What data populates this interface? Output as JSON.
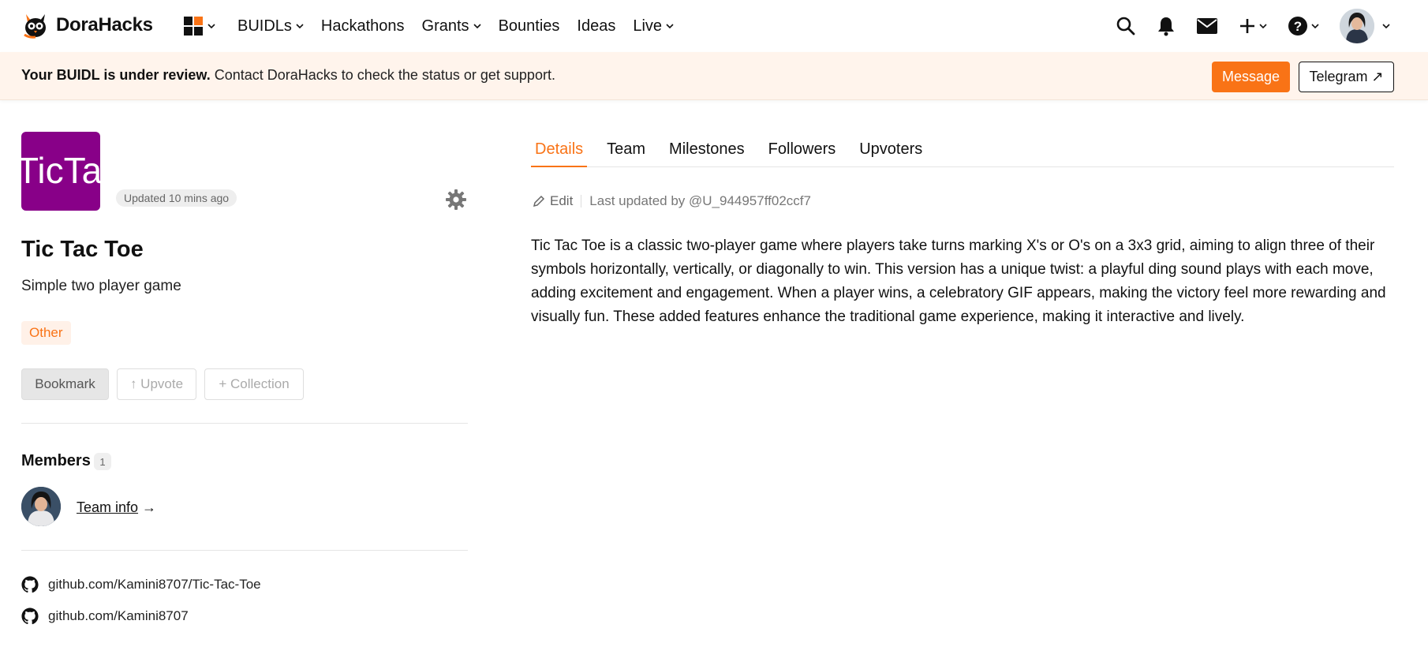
{
  "brand": {
    "name": "DoraHacks",
    "accent": "#f97316"
  },
  "nav": {
    "items": [
      {
        "label": "BUIDLs",
        "dropdown": true
      },
      {
        "label": "Hackathons",
        "dropdown": false
      },
      {
        "label": "Grants",
        "dropdown": true
      },
      {
        "label": "Bounties",
        "dropdown": false
      },
      {
        "label": "Ideas",
        "dropdown": false
      },
      {
        "label": "Live",
        "dropdown": true
      }
    ],
    "right_icons": [
      "search-icon",
      "bell-icon",
      "mail-icon",
      "plus-icon",
      "help-icon",
      "avatar"
    ]
  },
  "banner": {
    "bold": "Your BUIDL is under review.",
    "text": " Contact DoraHacks to check the status or get support.",
    "message_label": "Message",
    "telegram_label": "Telegram ↗"
  },
  "project": {
    "logo_text": "TicTac",
    "logo_color": "#880088",
    "updated": "Updated 10 mins ago",
    "title": "Tic Tac Toe",
    "tagline": "Simple two player game",
    "tag": "Other",
    "bookmark_label": "Bookmark",
    "upvote_label": "↑ Upvote",
    "collection_label": "+ Collection"
  },
  "members": {
    "label": "Members",
    "count": "1",
    "team_info_label": "Team info",
    "team_info_arrow": " →"
  },
  "links": [
    {
      "icon": "github-icon",
      "text": "github.com/Kamini8707/Tic-Tac-Toe"
    },
    {
      "icon": "github-icon",
      "text": "github.com/Kamini8707"
    }
  ],
  "tabs": [
    {
      "label": "Details",
      "active": true
    },
    {
      "label": "Team",
      "active": false
    },
    {
      "label": "Milestones",
      "active": false
    },
    {
      "label": "Followers",
      "active": false
    },
    {
      "label": "Upvoters",
      "active": false
    }
  ],
  "details": {
    "edit_label": "Edit",
    "last_updated": "Last updated by @U_944957ff02ccf7",
    "description": "Tic Tac Toe is a classic two-player game where players take turns marking X's or O's on a 3x3 grid, aiming to align three of their symbols horizontally, vertically, or diagonally to win. This version has a unique twist: a playful ding sound plays with each move, adding excitement and engagement. When a player wins, a celebratory GIF appears, making the victory feel more rewarding and visually fun. These added features enhance the traditional game experience, making it interactive and lively."
  }
}
